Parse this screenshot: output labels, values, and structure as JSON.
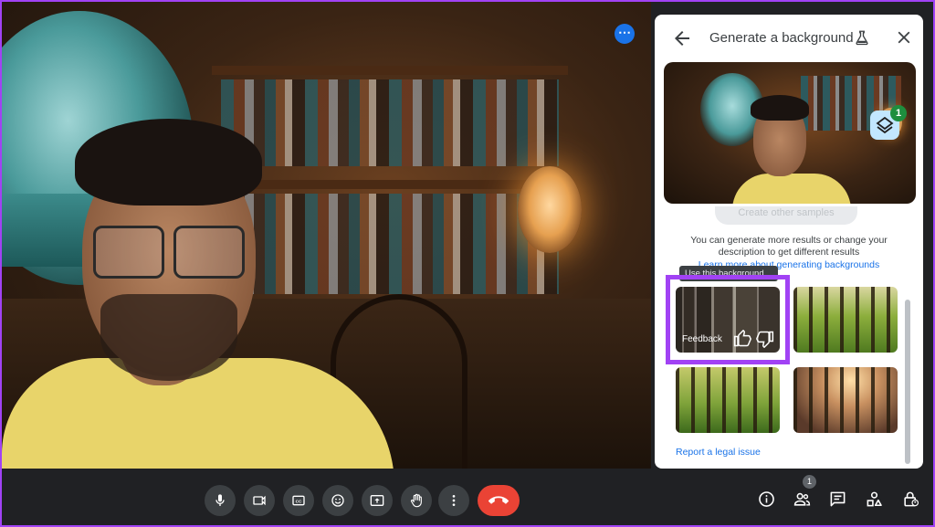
{
  "video": {
    "more_options_icon": "more-horiz-icon"
  },
  "panel": {
    "title": "Generate a background",
    "back_icon": "arrow-back-icon",
    "labs_icon": "flask-icon",
    "close_icon": "close-icon",
    "layers_badge": "1",
    "create_button": "Create other samples",
    "description": "You can generate more results or change your description to get different results",
    "learn_link": "Learn more about generating backgrounds",
    "tooltip": "Use this background",
    "feedback_label": "Feedback",
    "report_link": "Report a legal issue"
  },
  "toolbar": {
    "end_call_icon": "call-end-icon",
    "people_badge": "1"
  },
  "colors": {
    "highlight": "#a142f4",
    "accent_blue": "#1a73e8",
    "end_call": "#ea4335",
    "toolbar_bg": "#202124"
  }
}
